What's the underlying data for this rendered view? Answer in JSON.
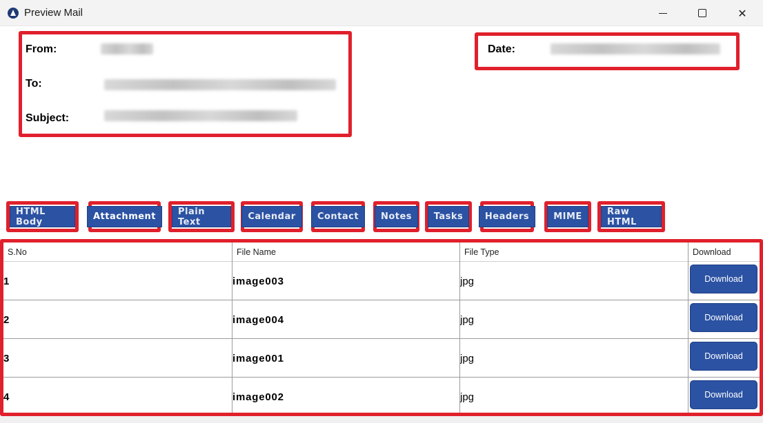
{
  "window": {
    "title": "Preview Mail",
    "minimize_icon": "minimize-icon",
    "maximize_icon": "maximize-icon",
    "close_icon": "close-icon"
  },
  "header": {
    "from_label": "From:",
    "to_label": "To:",
    "subject_label": "Subject:",
    "date_label": "Date:"
  },
  "tabs": [
    {
      "label": "HTML Body"
    },
    {
      "label": "Attachment"
    },
    {
      "label": "Plain Text"
    },
    {
      "label": "Calendar"
    },
    {
      "label": "Contact"
    },
    {
      "label": "Notes"
    },
    {
      "label": "Tasks"
    },
    {
      "label": "Headers"
    },
    {
      "label": "MIME"
    },
    {
      "label": "Raw HTML"
    }
  ],
  "active_tab": "Attachment",
  "table": {
    "columns": [
      "S.No",
      "File Name",
      "File Type",
      "Download"
    ],
    "rows": [
      {
        "sno": "1",
        "name": "image003",
        "type": "jpg",
        "action": "Download"
      },
      {
        "sno": "2",
        "name": "image004",
        "type": "jpg",
        "action": "Download"
      },
      {
        "sno": "3",
        "name": "image001",
        "type": "jpg",
        "action": "Download"
      },
      {
        "sno": "4",
        "name": "image002",
        "type": "jpg",
        "action": "Download"
      }
    ]
  },
  "colors": {
    "highlight": "#e0202c",
    "button": "#2b52a3"
  }
}
